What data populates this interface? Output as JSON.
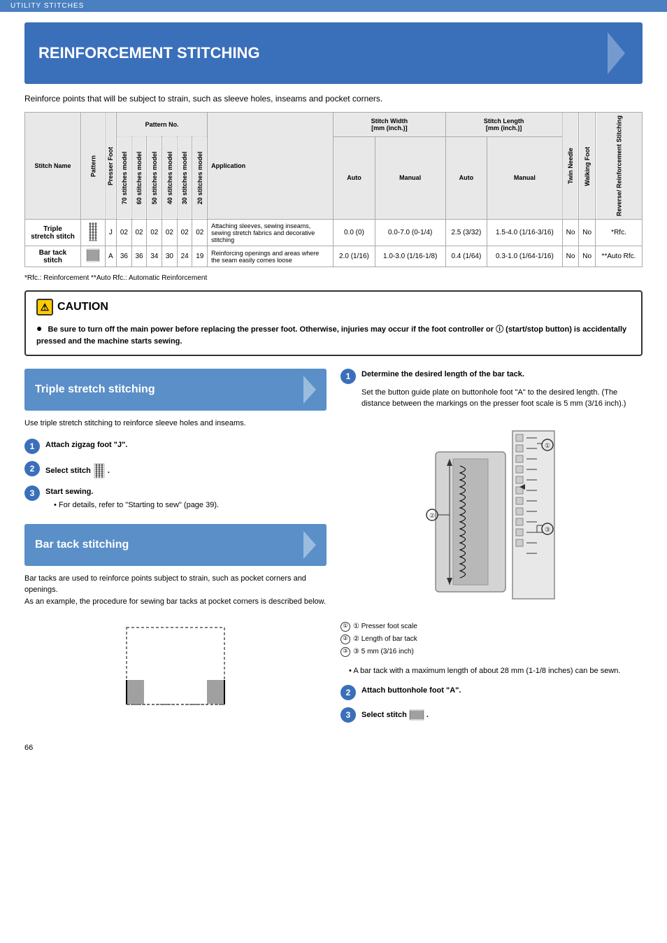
{
  "utilityBar": {
    "label": "UTILITY STITCHES"
  },
  "mainTitle": "REINFORCEMENT STITCHING",
  "introText": "Reinforce points that will be subject to strain, such as sleeve holes, inseams and pocket corners.",
  "table": {
    "headers": {
      "patternNo": "Pattern No.",
      "stitchWidth": "Stitch Width [mm (inch.)]",
      "stitchLength": "Stitch Length [mm (inch.)]",
      "colHeaders": [
        "Stitch Name",
        "Pattern",
        "Presser Foot",
        "70 stitches model",
        "60 stitches model",
        "50 stitches model",
        "40 stitches model",
        "30 stitches model",
        "20 stitches model",
        "Application",
        "Auto",
        "Manual",
        "Auto",
        "Manual",
        "Twin Needle",
        "Walking Foot",
        "Reverse/ Reinforcement Stitching"
      ]
    },
    "rows": [
      {
        "name": "Triple stretch stitch",
        "pattern": "triple",
        "presserFoot": "J",
        "p70": "02",
        "p60": "02",
        "p50": "02",
        "p40": "02",
        "p30": "02",
        "p20": "02",
        "application": "Attaching sleeves, sewing inseams, sewing stretch fabrics and decorative stitching",
        "swAuto": "0.0 (0)",
        "swManual": "0.0-7.0 (0-1/4)",
        "slAuto": "2.5 (3/32)",
        "slManual": "1.5-4.0 (1/16-3/16)",
        "twinNeedle": "No",
        "walkingFoot": "No",
        "reverse": "*Rfc."
      },
      {
        "name": "Bar tack stitch",
        "pattern": "bartack",
        "presserFoot": "A",
        "p70": "36",
        "p60": "36",
        "p50": "34",
        "p40": "30",
        "p30": "24",
        "p20": "19",
        "application": "Reinforcing openings and areas where the seam easily comes loose",
        "swAuto": "2.0 (1/16)",
        "swManual": "1.0-3.0 (1/16-1/8)",
        "slAuto": "0.4 (1/64)",
        "slManual": "0.3-1.0 (1/64-1/16)",
        "twinNeedle": "No",
        "walkingFoot": "No",
        "reverse": "**Auto Rfc."
      }
    ],
    "footnotes": "*Rfc.: Reinforcement     **Auto Rfc.: Automatic Reinforcement"
  },
  "caution": {
    "title": "CAUTION",
    "text": "Be sure to turn off the main power before replacing the presser foot. Otherwise, injuries may occur if the foot controller or",
    "text2": "(start/stop button) is accidentally pressed and the machine starts sewing."
  },
  "tripleSection": {
    "title": "Triple stretch stitching",
    "bodyText": "Use triple stretch stitching to reinforce sleeve holes and inseams.",
    "steps": [
      {
        "num": "1",
        "text": "Attach zigzag foot \"J\"."
      },
      {
        "num": "2",
        "text": "Select stitch"
      },
      {
        "num": "3",
        "text": "Start sewing.",
        "subBullet": "For details, refer to \"Starting to sew\" (page 39)."
      }
    ]
  },
  "barTackSection": {
    "title": "Bar tack stitching",
    "bodyText": "Bar tacks are used to reinforce points subject to strain, such as pocket corners and openings.\nAs an example, the procedure for sewing bar tacks at pocket corners is described below."
  },
  "rightColumn": {
    "step1": {
      "num": "1",
      "title": "Determine the desired length of the bar tack.",
      "body": "Set the button guide plate on buttonhole foot \"A\" to the desired length. (The distance between the markings on the presser foot scale is 5 mm (3/16 inch).)"
    },
    "legend": [
      "① Presser foot scale",
      "② Length of bar tack",
      "③ 5 mm (3/16 inch)"
    ],
    "bullet": "A bar tack with a maximum length of about 28 mm (1-1/8 inches) can be sewn.",
    "step2": {
      "num": "2",
      "title": "Attach buttonhole foot \"A\"."
    },
    "step3": {
      "num": "3",
      "text": "Select stitch"
    }
  },
  "pageNumber": "66"
}
